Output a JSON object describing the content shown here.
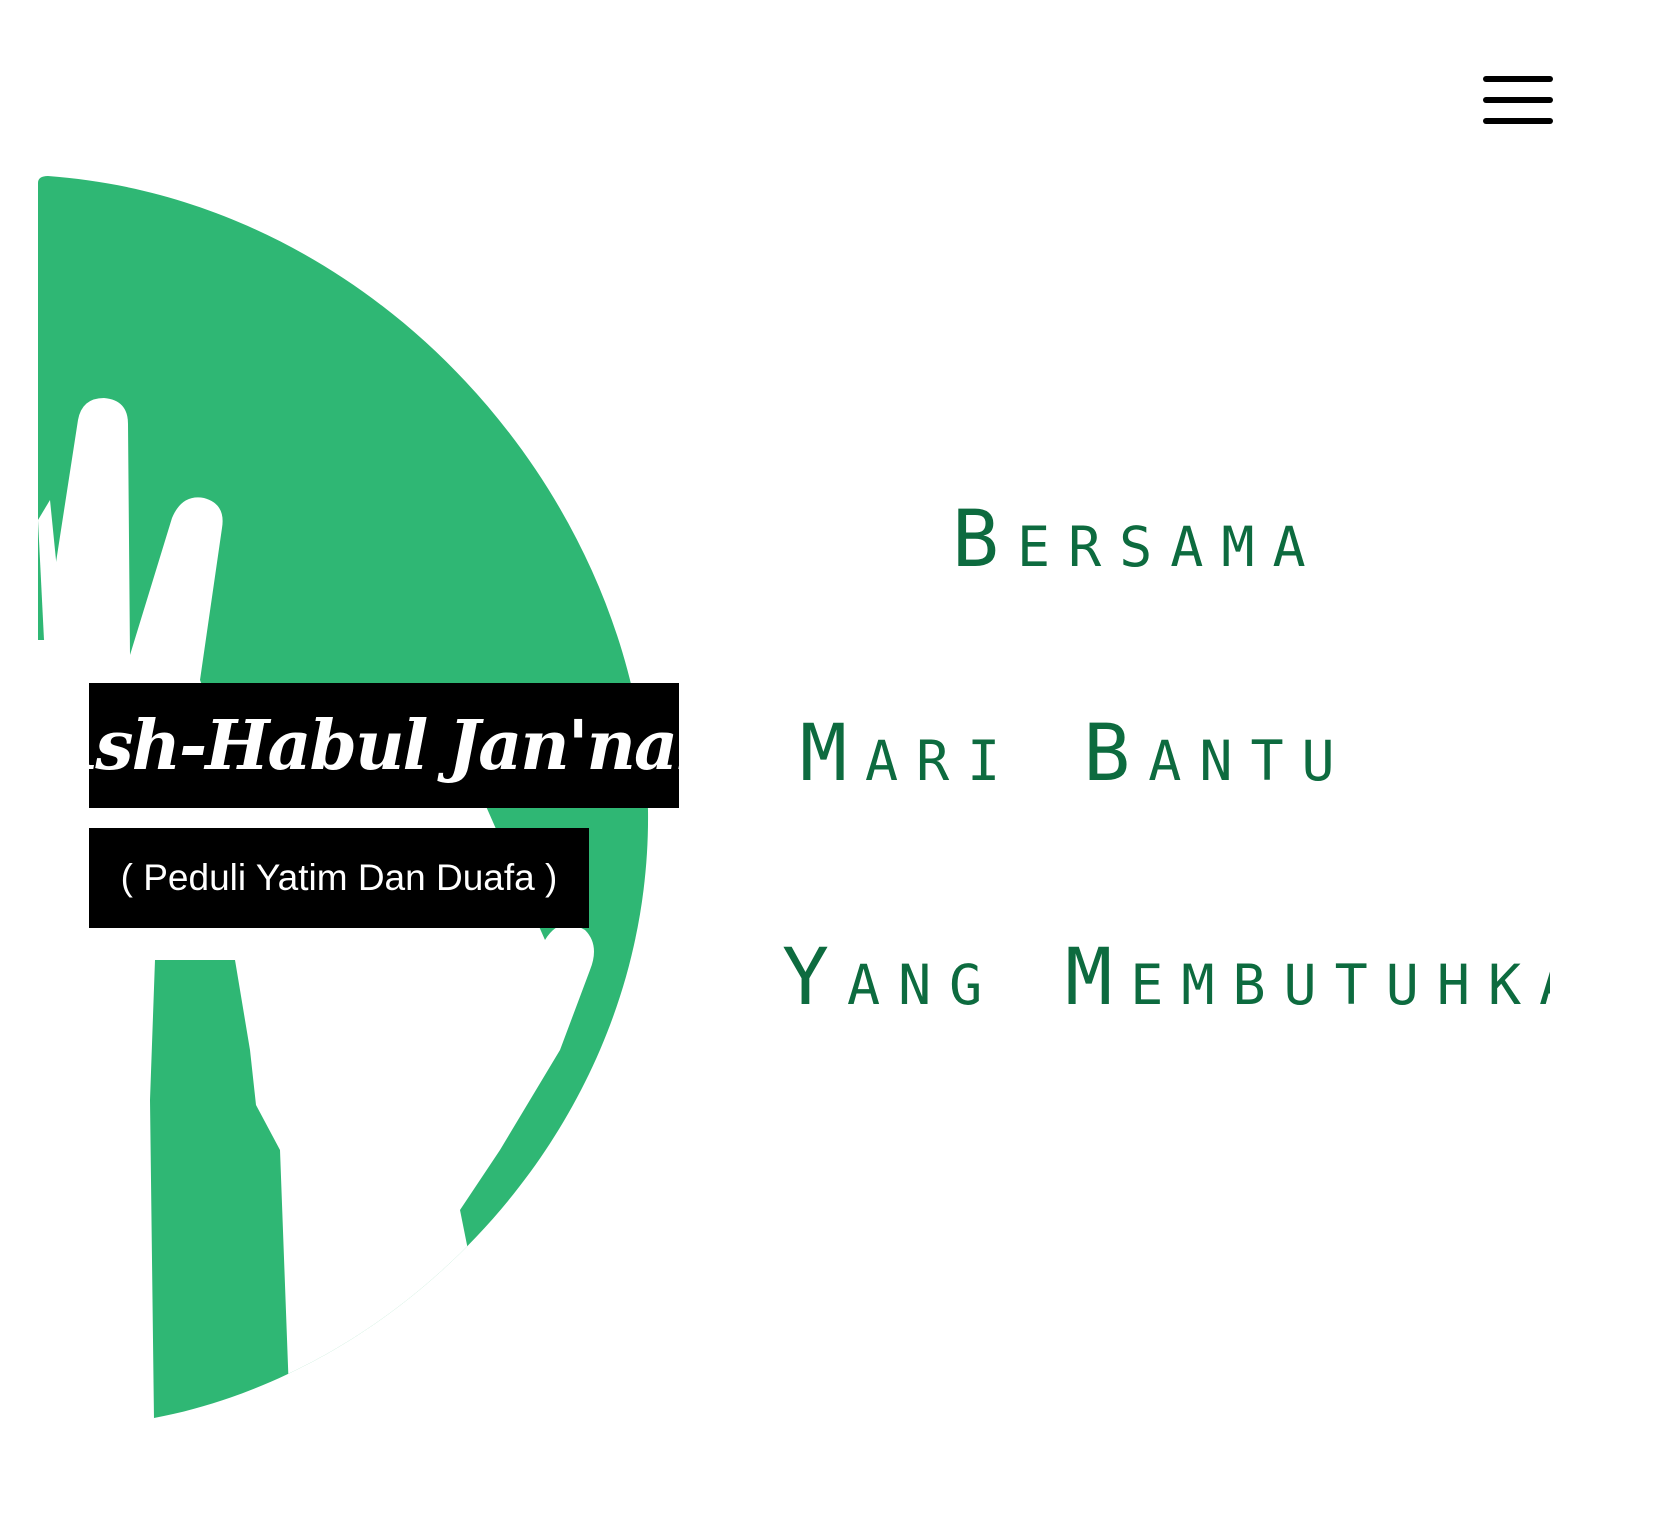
{
  "header": {
    "menu_icon": "hamburger-menu-icon"
  },
  "hero": {
    "tagline": [
      "Bersama",
      "Mari Bantu",
      "Yang Membutuhkan"
    ]
  },
  "brand": {
    "title": "Ash-Habul Jan'nah",
    "subtitle": "( Peduli Yatim Dan Duafa )"
  },
  "colors": {
    "logo_green": "#2fb774",
    "tagline_green": "#0d6b3f",
    "label_background": "#000000",
    "label_text": "#ffffff"
  }
}
